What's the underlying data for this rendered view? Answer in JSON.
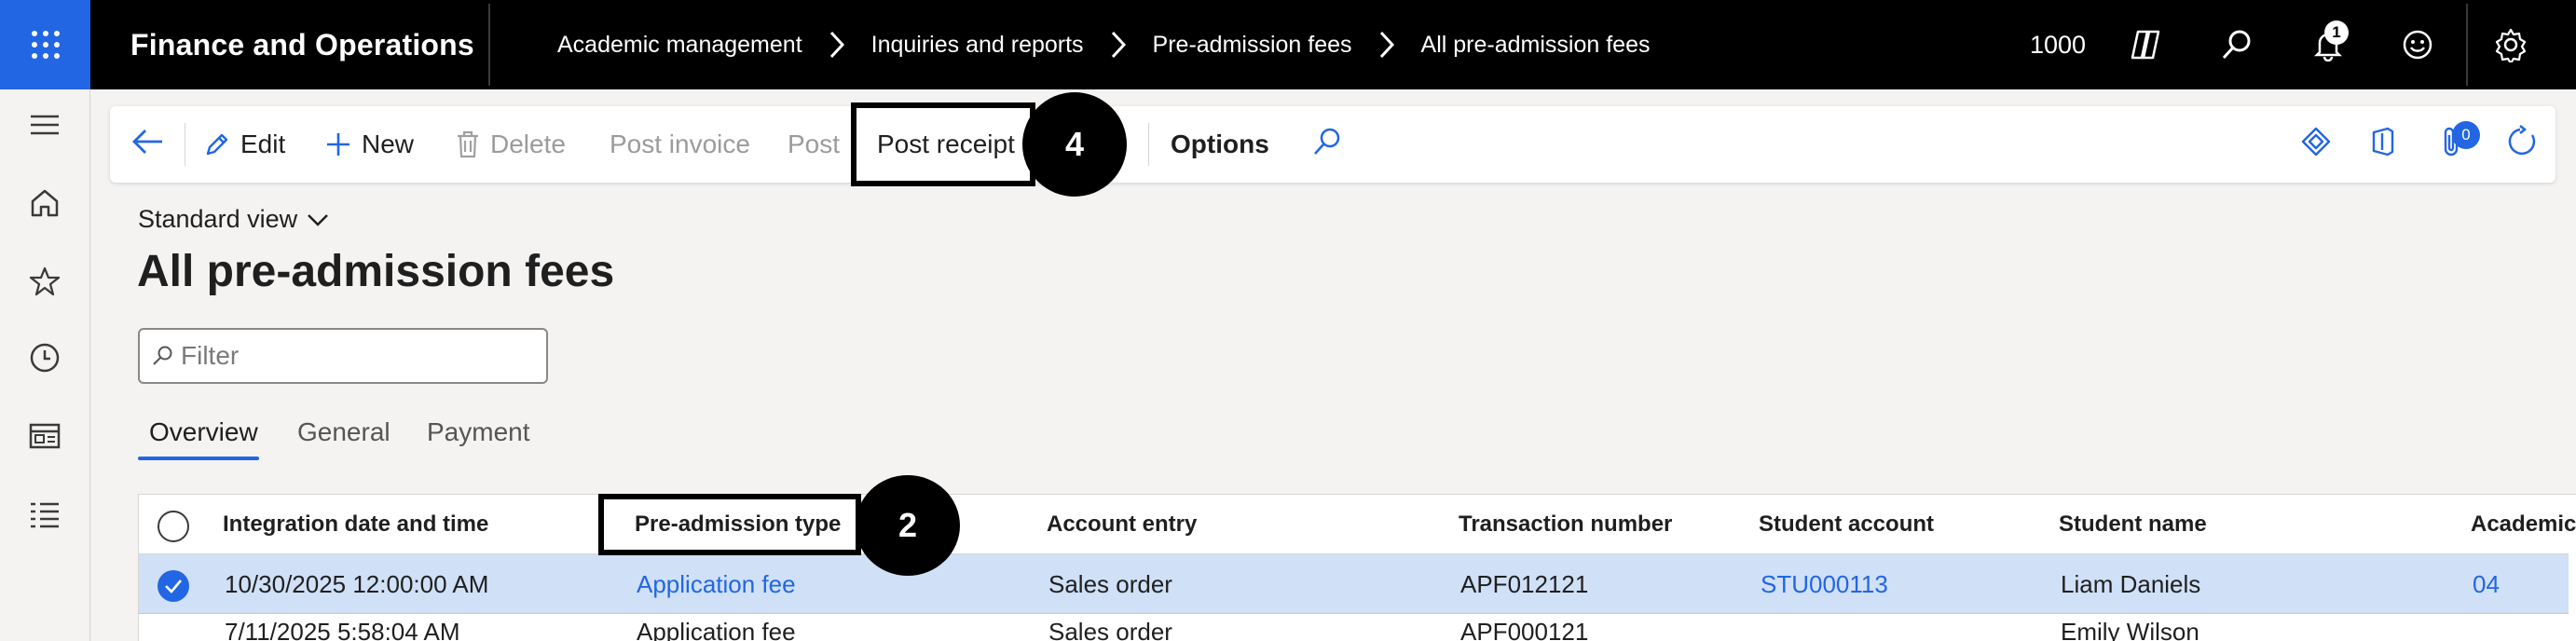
{
  "topbar": {
    "app_title": "Finance and Operations",
    "breadcrumb": [
      "Academic management",
      "Inquiries and reports",
      "Pre-admission fees",
      "All pre-admission fees"
    ],
    "company": "1000",
    "notification_count": "1",
    "icons": [
      "waffle-icon",
      "copilot-icon",
      "search-icon",
      "bell-icon",
      "smiley-icon",
      "gear-icon"
    ]
  },
  "leftrail": {
    "icons": [
      "hamburger-icon",
      "home-icon",
      "star-icon",
      "clock-icon",
      "workspace-icon",
      "list-icon"
    ]
  },
  "actionpane": {
    "edit": "Edit",
    "new": "New",
    "delete": "Delete",
    "post_invoice": "Post invoice",
    "post": "Post",
    "post_receipt": "Post receipt",
    "options": "Options",
    "attachment_count": "0"
  },
  "callouts": {
    "post_receipt": "4",
    "preadmission_type": "2"
  },
  "page": {
    "view": "Standard view",
    "title": "All pre-admission fees",
    "filter_placeholder": "Filter",
    "tabs": [
      "Overview",
      "General",
      "Payment"
    ]
  },
  "grid": {
    "columns": [
      "Integration date and time",
      "Pre-admission type",
      "Account entry",
      "Transaction number",
      "Student account",
      "Student name",
      "Academic"
    ],
    "rows": [
      [
        "10/30/2025 12:00:00 AM",
        "Application fee",
        "Sales order",
        "APF012121",
        "STU000113",
        "Liam Daniels",
        "04"
      ],
      [
        "7/11/2025 5:58:04 AM",
        "Application fee",
        "Sales order",
        "APF000121",
        "",
        "Emily Wilson",
        ""
      ]
    ]
  },
  "colors": {
    "accent": "#2266e3",
    "selected_row": "#cfe0f7",
    "topbar": "#000000"
  }
}
